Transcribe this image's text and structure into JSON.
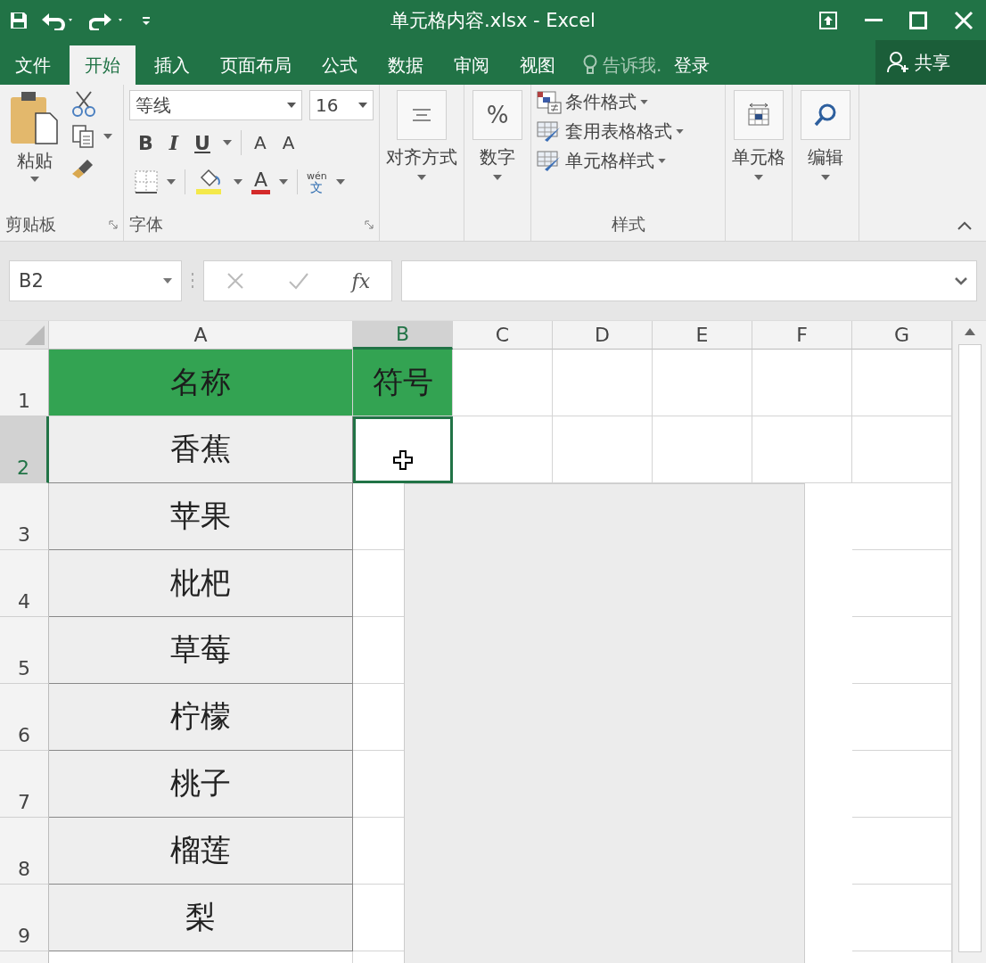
{
  "window": {
    "title": "单元格内容.xlsx - Excel"
  },
  "tabs": [
    {
      "label": "文件",
      "selected": false
    },
    {
      "label": "开始",
      "selected": true
    },
    {
      "label": "插入",
      "selected": false
    },
    {
      "label": "页面布局",
      "selected": false
    },
    {
      "label": "公式",
      "selected": false
    },
    {
      "label": "数据",
      "selected": false
    },
    {
      "label": "审阅",
      "selected": false
    },
    {
      "label": "视图",
      "selected": false
    }
  ],
  "tell_me": "告诉我.",
  "sign_in": "登录",
  "share": "共享",
  "clipboard": {
    "paste": "粘贴",
    "label": "剪贴板"
  },
  "font": {
    "name": "等线",
    "size": "16",
    "bold": "B",
    "italic": "I",
    "underline": "U",
    "grow": "A",
    "shrink": "A",
    "font_color": "A",
    "phonetic_top": "wén",
    "phonetic_bottom": "文",
    "label": "字体"
  },
  "alignment": "对齐方式",
  "number_icon": "%",
  "number": "数字",
  "styles": {
    "items": [
      "条件格式",
      "套用表格格式",
      "单元格样式"
    ],
    "label": "样式"
  },
  "cells": "单元格",
  "editing": "编辑",
  "formula_bar": {
    "name_box": "B2",
    "fx": "fx"
  },
  "columns": [
    {
      "label": "A",
      "selected": false
    },
    {
      "label": "B",
      "selected": true
    },
    {
      "label": "C",
      "selected": false
    },
    {
      "label": "D",
      "selected": false
    },
    {
      "label": "E",
      "selected": false
    },
    {
      "label": "F",
      "selected": false
    },
    {
      "label": "G",
      "selected": false
    }
  ],
  "rows": [
    {
      "number": "1",
      "selected": false,
      "kind": "header",
      "cells": [
        "名称",
        "符号"
      ]
    },
    {
      "number": "2",
      "selected": true,
      "kind": "data",
      "cells": [
        "香蕉"
      ]
    },
    {
      "number": "3",
      "selected": false,
      "kind": "data",
      "cells": [
        "苹果"
      ]
    },
    {
      "number": "4",
      "selected": false,
      "kind": "data",
      "cells": [
        "枇杷"
      ]
    },
    {
      "number": "5",
      "selected": false,
      "kind": "data",
      "cells": [
        "草莓"
      ]
    },
    {
      "number": "6",
      "selected": false,
      "kind": "data",
      "cells": [
        "柠檬"
      ]
    },
    {
      "number": "7",
      "selected": false,
      "kind": "data",
      "cells": [
        "桃子"
      ]
    },
    {
      "number": "8",
      "selected": false,
      "kind": "data",
      "cells": [
        "榴莲"
      ]
    },
    {
      "number": "9",
      "selected": false,
      "kind": "data",
      "cells": [
        "梨"
      ]
    }
  ]
}
